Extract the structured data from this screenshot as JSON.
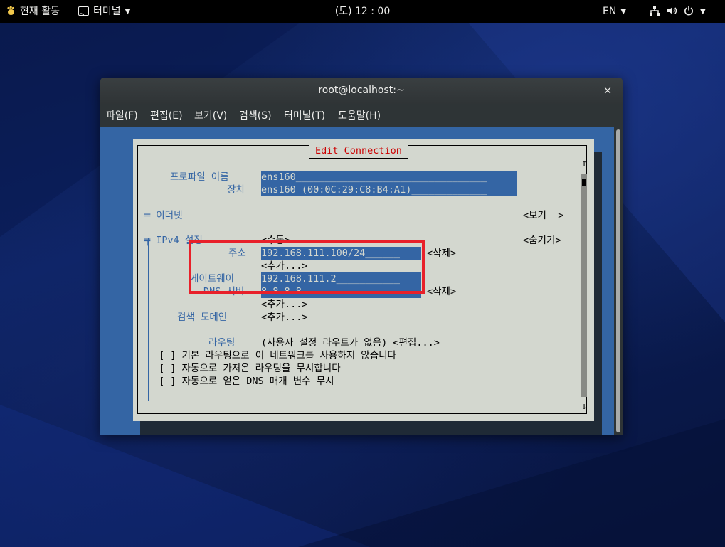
{
  "topbar": {
    "activities": "현재 활동",
    "app_menu": "터미널",
    "clock": "(토) 12 : 00",
    "language": "EN"
  },
  "window": {
    "title": "root@localhost:~",
    "close": "×",
    "menu": {
      "file": "파일(F)",
      "edit": "편집(E)",
      "view": "보기(V)",
      "search": "검색(S)",
      "terminal": "터미널(T)",
      "help": "도움말(H)"
    }
  },
  "dialog": {
    "title": "Edit Connection",
    "profile_label": "프로파일 이름",
    "profile_value": "ens160_________________________________",
    "device_label": "장치",
    "device_value": "ens160 (00:0C:29:C8:B4:A1)_____________",
    "ethernet_label": "═ 이더넷",
    "ethernet_button": "<보기  >",
    "ipv4_label": "╤ IPv4 설정",
    "ipv4_mode": "<수동>",
    "ipv4_hide": "<숨기기>",
    "address_label": "주소",
    "address_value": "192.168.111.100/24______",
    "address_delete": "<삭제>",
    "address_add": "<추가...>",
    "gateway_label": "게이트웨이",
    "gateway_value": "192.168.111.2___________",
    "dns_label": "DNS 서버",
    "dns_value": "8.8.8.8                 ",
    "dns_delete": "<삭제>",
    "dns_add": "<추가...>",
    "search_domain_label": "검색 도메인",
    "search_domain_add": "<추가...>",
    "routing_label": "라우팅",
    "routing_value": "(사용자 설정 라우트가 없음) <편집...>",
    "check_no_default": "[ ] 기본 라우팅으로 이 네트워크를 사용하지 않습니다",
    "check_ignore_routes": "[ ] 자동으로 가져온 라우팅을 무시합니다",
    "check_ignore_dns": "[ ] 자동으로 얻은 DNS 매개 변수 무시",
    "scroll_up": "↑",
    "scroll_down": "↓"
  },
  "colors": {
    "terminal_bg": "#3465a4",
    "dialog_bg": "#d3d7cf",
    "title_red": "#cc0000",
    "highlight_box": "#e8202a"
  }
}
